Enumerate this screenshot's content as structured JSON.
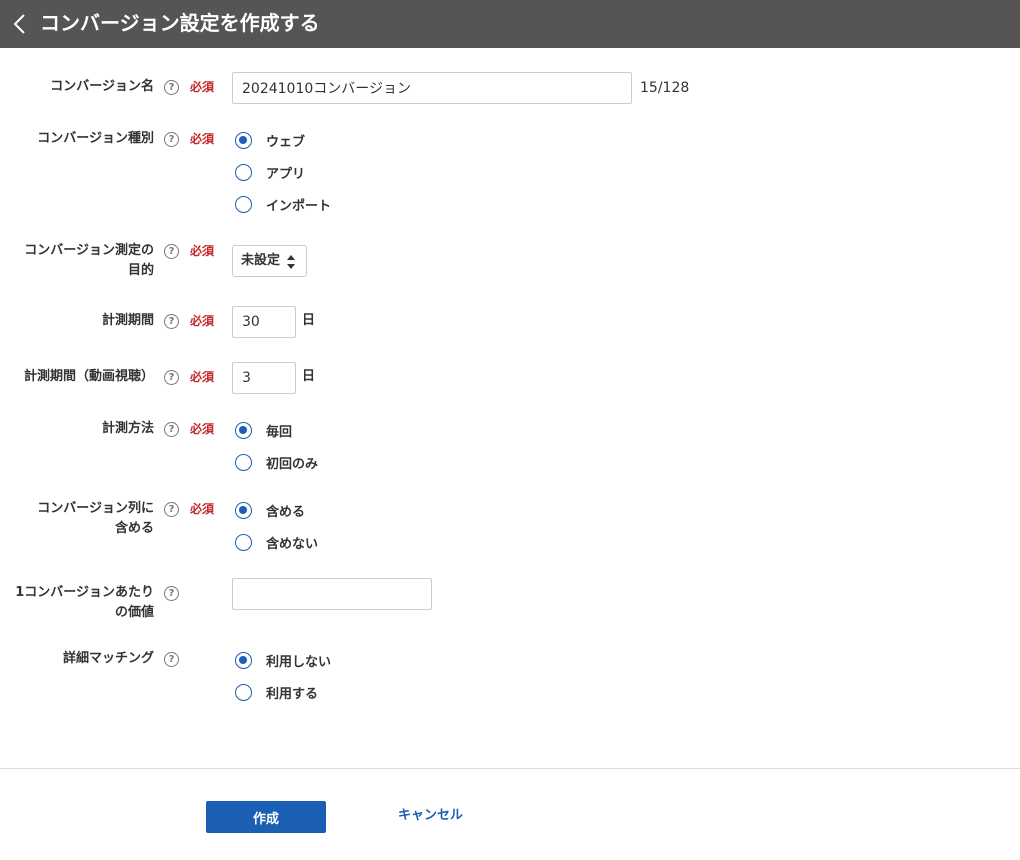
{
  "header": {
    "title": "コンバージョン設定を作成する",
    "back_icon": "chevron-left-icon"
  },
  "help_glyph": "?",
  "required_label": "必須",
  "fields": {
    "name": {
      "label": "コンバージョン名",
      "value": "20241010コンバージョン",
      "counter": "15/128"
    },
    "type": {
      "label": "コンバージョン種別",
      "options": [
        "ウェブ",
        "アプリ",
        "インポート"
      ],
      "selected": "ウェブ"
    },
    "purpose": {
      "label_line1": "コンバージョン測定の",
      "label_line2": "目的",
      "value": "未設定"
    },
    "period": {
      "label": "計測期間",
      "value": "30",
      "unit": "日"
    },
    "video_period": {
      "label": "計測期間（動画視聴）",
      "value": "3",
      "unit": "日"
    },
    "method": {
      "label": "計測方法",
      "options": [
        "毎回",
        "初回のみ"
      ],
      "selected": "毎回"
    },
    "include_column": {
      "label_line1": "コンバージョン列に",
      "label_line2": "含める",
      "options": [
        "含める",
        "含めない"
      ],
      "selected": "含める"
    },
    "value_per_conversion": {
      "label_line1": "1コンバージョンあたり",
      "label_line2": "の価値",
      "value": ""
    },
    "advanced_matching": {
      "label": "詳細マッチング",
      "options": [
        "利用しない",
        "利用する"
      ],
      "selected": "利用しない"
    }
  },
  "footer": {
    "create_label": "作成",
    "cancel_label": "キャンセル"
  },
  "colors": {
    "header_bg": "#555555",
    "accent": "#1a5fb4",
    "required": "#c62828"
  }
}
